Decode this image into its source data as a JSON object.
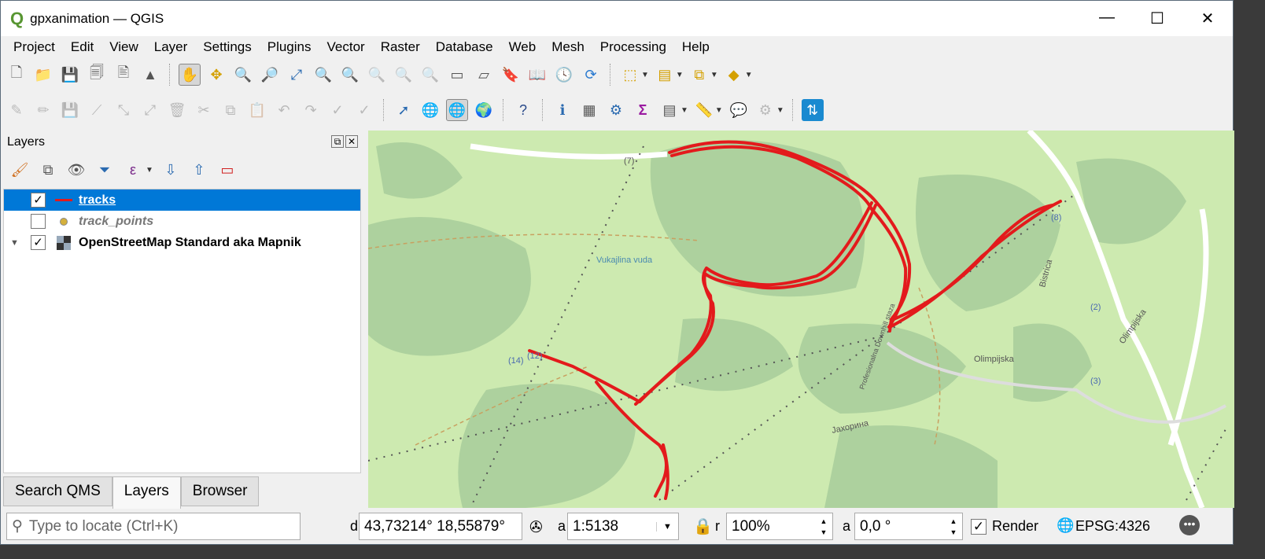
{
  "window": {
    "title": "gpxanimation — QGIS",
    "min": "—",
    "max": "☐",
    "close": "✕"
  },
  "menu": [
    "Project",
    "Edit",
    "View",
    "Layer",
    "Settings",
    "Plugins",
    "Vector",
    "Raster",
    "Database",
    "Web",
    "Mesh",
    "Processing",
    "Help"
  ],
  "layers_panel": {
    "title": "Layers",
    "layers": [
      {
        "name": "tracks",
        "checked": true,
        "selected": true,
        "symbol": "line",
        "color": "#e31a1c"
      },
      {
        "name": "track_points",
        "checked": false,
        "symbol": "point",
        "color": "#d4b03c"
      },
      {
        "name": "OpenStreetMap Standard aka Mapnik",
        "checked": true,
        "symbol": "raster",
        "expanded": true
      }
    ]
  },
  "bottom_tabs": [
    "Search QMS",
    "Layers",
    "Browser"
  ],
  "map_labels": [
    "(7)",
    "Vukajlina vuda",
    "(14)",
    "(12)",
    "(8)",
    "(2)",
    "(3)",
    "Olimpijska",
    "Olimpijska",
    "Bistrica",
    "Profesionalna Downhill staza",
    "Јахорина"
  ],
  "status": {
    "locator_placeholder": "Type to locate (Ctrl+K)",
    "coordinate_label": "d",
    "coordinate": "43,73214°  18,55879°",
    "scale_label": "a",
    "scale": "1:5138",
    "magnifier_label": "r",
    "magnifier": "100%",
    "rotation_label": "a",
    "rotation": "0,0 °",
    "render_label": "Render",
    "render_checked": true,
    "crs": "EPSG:4326"
  },
  "colors": {
    "track": "#e31a1c",
    "selection": "#0078d7",
    "map_bg": "#cdeab0",
    "forest": "#add19e"
  }
}
